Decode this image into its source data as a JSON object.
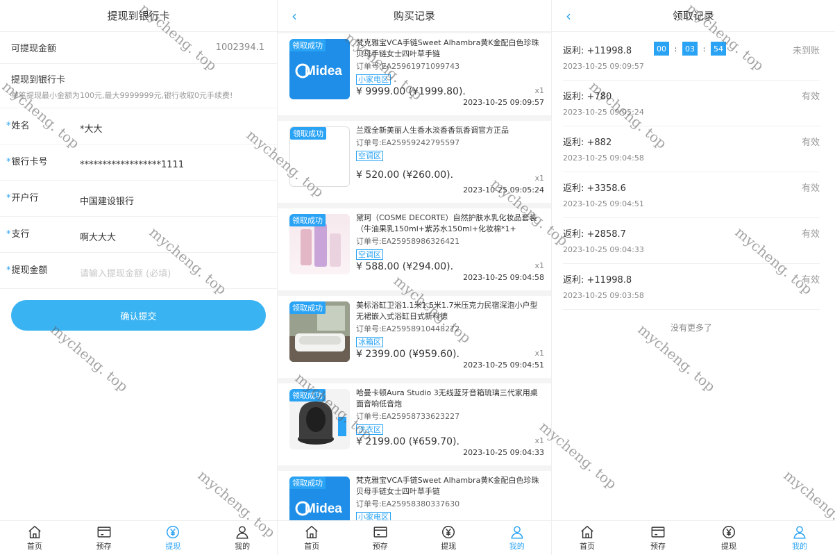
{
  "withdraw": {
    "title": "提现到银行卡",
    "avail_label": "可提现金额",
    "avail_value": "1002394.1",
    "bank_title": "提现到银行卡",
    "bank_note": "单笔提现最小金额为100元,最大9999999元,银行收取0元手续费!",
    "fields": [
      {
        "label": "姓名",
        "value": "*大大"
      },
      {
        "label": "银行卡号",
        "value": "******************1111"
      },
      {
        "label": "开户行",
        "value": "中国建设银行"
      },
      {
        "label": "支行",
        "value": "啊大大大"
      },
      {
        "label": "提现金额",
        "placeholder": "请输入提现金额 (必填)"
      }
    ],
    "submit_label": "确认提交"
  },
  "purchases": {
    "title": "购买记录",
    "items": [
      {
        "badge": "领取成功",
        "name": "梵克雅宝VCA手链Sweet Alhambra黄K金配白色珍珠贝母手链女士四叶草手链",
        "order": "订单号:EA25961971099743",
        "tag": "小家电区",
        "price": "¥ 9999.00 (¥1999.80).",
        "qty": "x1",
        "time": "2023-10-25 09:09:57",
        "thumb": "midea"
      },
      {
        "badge": "领取成功",
        "name": "兰蔻全新美丽人生香水淡香香氛香调官方正品",
        "order": "订单号:EA25959242795597",
        "tag": "空调区",
        "price": "¥ 520.00 (¥260.00).",
        "qty": "x1",
        "time": "2023-10-25 09:05:24",
        "thumb": "blank"
      },
      {
        "badge": "领取成功",
        "name": "黛珂（COSME DECORTE）自然护肤水乳化妆品套装（牛油果乳150ml+紫苏水150ml+化妆棉*1+",
        "order": "订单号:EA25958986326421",
        "tag": "空调区",
        "price": "¥ 588.00 (¥294.00).",
        "qty": "x1",
        "time": "2023-10-25 09:04:58",
        "thumb": "cosmetic"
      },
      {
        "badge": "领取成功",
        "name": "美标浴缸卫浴1.1米1.5米1.7米压克力民宿深泡小户型无裙嵌入式浴缸日式新科德",
        "order": "订单号:EA25958910448272",
        "tag": "冰箱区",
        "price": "¥ 2399.00 (¥959.60).",
        "qty": "x1",
        "time": "2023-10-25 09:04:51",
        "thumb": "bathtub"
      },
      {
        "badge": "领取成功",
        "name": "哈曼卡顿Aura Studio 3无线蓝牙音箱琉璃三代家用桌面音响低音炮",
        "order": "订单号:EA25958733623227",
        "tag": "洗衣区",
        "price": "¥ 2199.00 (¥659.70).",
        "qty": "x1",
        "time": "2023-10-25 09:04:33",
        "thumb": "speaker"
      },
      {
        "badge": "领取成功",
        "name": "梵克雅宝VCA手链Sweet Alhambra黄K金配白色珍珠贝母手链女士四叶草手链",
        "order": "订单号:EA25958380337630",
        "tag": "小家电区",
        "price": "",
        "qty": "",
        "time": "",
        "thumb": "midea"
      }
    ]
  },
  "records": {
    "title": "领取记录",
    "items": [
      {
        "amount": "返利: +11998.8",
        "time": "2023-10-25 09:09:57",
        "status": "未到账",
        "countdown": [
          "00",
          "03",
          "54"
        ]
      },
      {
        "amount": "返利: +780",
        "time": "2023-10-25 09:05:24",
        "status": "有效"
      },
      {
        "amount": "返利: +882",
        "time": "2023-10-25 09:04:58",
        "status": "有效"
      },
      {
        "amount": "返利: +3358.6",
        "time": "2023-10-25 09:04:51",
        "status": "有效"
      },
      {
        "amount": "返利: +2858.7",
        "time": "2023-10-25 09:04:33",
        "status": "有效"
      },
      {
        "amount": "返利: +11998.8",
        "time": "2023-10-25 09:03:58",
        "status": "有效"
      }
    ],
    "no_more": "没有更多了",
    "countdown_sep": ":"
  },
  "tabs": {
    "home": "首页",
    "deposit": "预存",
    "withdraw": "提现",
    "mine": "我的"
  },
  "brand": {
    "midea": "Midea"
  },
  "watermark": "mycheng. top",
  "colors": {
    "accent": "#2aa3f5",
    "button": "#3ab3f2"
  }
}
